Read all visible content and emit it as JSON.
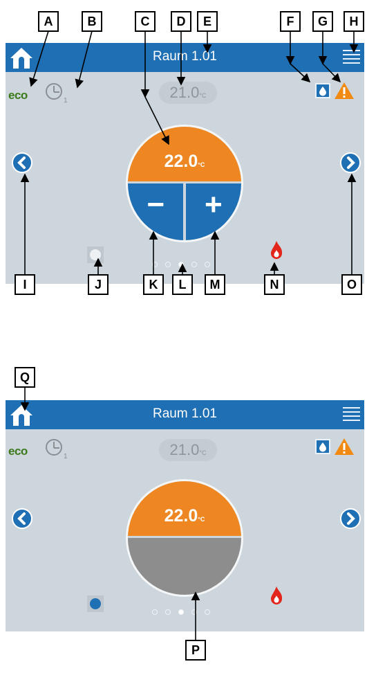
{
  "panel_top": {
    "title": "Raum 1.01",
    "eco_label": "eco",
    "clock_sub": "1",
    "setpoint_value": "21.0",
    "setpoint_unit": "°C",
    "dial_value": "22.0",
    "dial_unit": "°C",
    "minus_label": "−",
    "plus_label": "+",
    "page_dots": 5,
    "active_dot": 3
  },
  "panel_bottom": {
    "title": "Raum 1.01",
    "eco_label": "eco",
    "clock_sub": "1",
    "setpoint_value": "21.0",
    "setpoint_unit": "°C",
    "dial_value": "22.0",
    "dial_unit": "°C",
    "page_dots": 5,
    "active_dot": 3
  },
  "callouts": [
    "A",
    "B",
    "C",
    "D",
    "E",
    "F",
    "G",
    "H",
    "I",
    "J",
    "K",
    "L",
    "M",
    "N",
    "O",
    "Q",
    "P"
  ],
  "colors": {
    "bar": "#1f6fb4",
    "panel": "#cdd6dc",
    "orange": "#ee8722",
    "grey_half": "#8d8d8d",
    "eco_green": "#3b7a1a",
    "flame": "#e2261c",
    "warning": "#f08a12"
  },
  "icons": [
    "home-icon",
    "menu-icon",
    "clock-icon",
    "water-drop-icon",
    "warning-icon",
    "chevron-left-icon",
    "chevron-right-icon",
    "flame-icon",
    "status-indicator"
  ]
}
